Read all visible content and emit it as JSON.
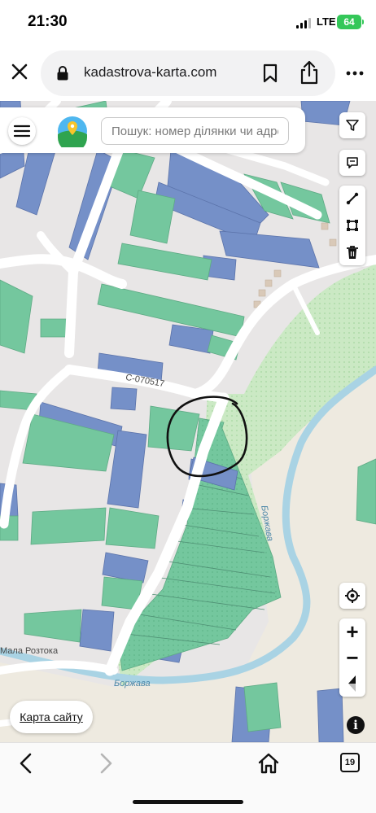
{
  "status_bar": {
    "time": "21:30",
    "network": "LTE",
    "battery": "64"
  },
  "browser": {
    "url": "kadastrova-karta.com",
    "icons": [
      "close-icon",
      "lock-icon",
      "bookmark-icon",
      "share-icon",
      "more-icon"
    ]
  },
  "map": {
    "search_placeholder": "Пошук: номер ділянки чи адреса",
    "sitemap_link": "Карта сайту",
    "info_symbol": "i",
    "zoom_in": "+",
    "zoom_out": "−",
    "labels": {
      "street": "С-070517",
      "river_vertical": "Боржава",
      "river_bottom": "Боржава",
      "village": "Мала Розтока"
    },
    "tools": [
      "filter-icon",
      "comment-icon",
      "line-measure-icon",
      "area-measure-icon",
      "delete-icon"
    ],
    "controls": [
      "locate-icon",
      "zoom-in-button",
      "zoom-out-button",
      "compass-icon"
    ],
    "colors": {
      "background": "#e8e6e6",
      "parcel_blue": "#7590c8",
      "parcel_green": "#74c79e",
      "forest": "#cbe9c4",
      "road": "#ffffff",
      "river": "#a9d3e4",
      "land_beige": "#eeeae0",
      "annotation": "#111111"
    }
  },
  "bottom_bar": {
    "tab_count": "19",
    "icons": [
      "back-icon",
      "forward-icon",
      "home-icon",
      "tabs-icon"
    ]
  }
}
